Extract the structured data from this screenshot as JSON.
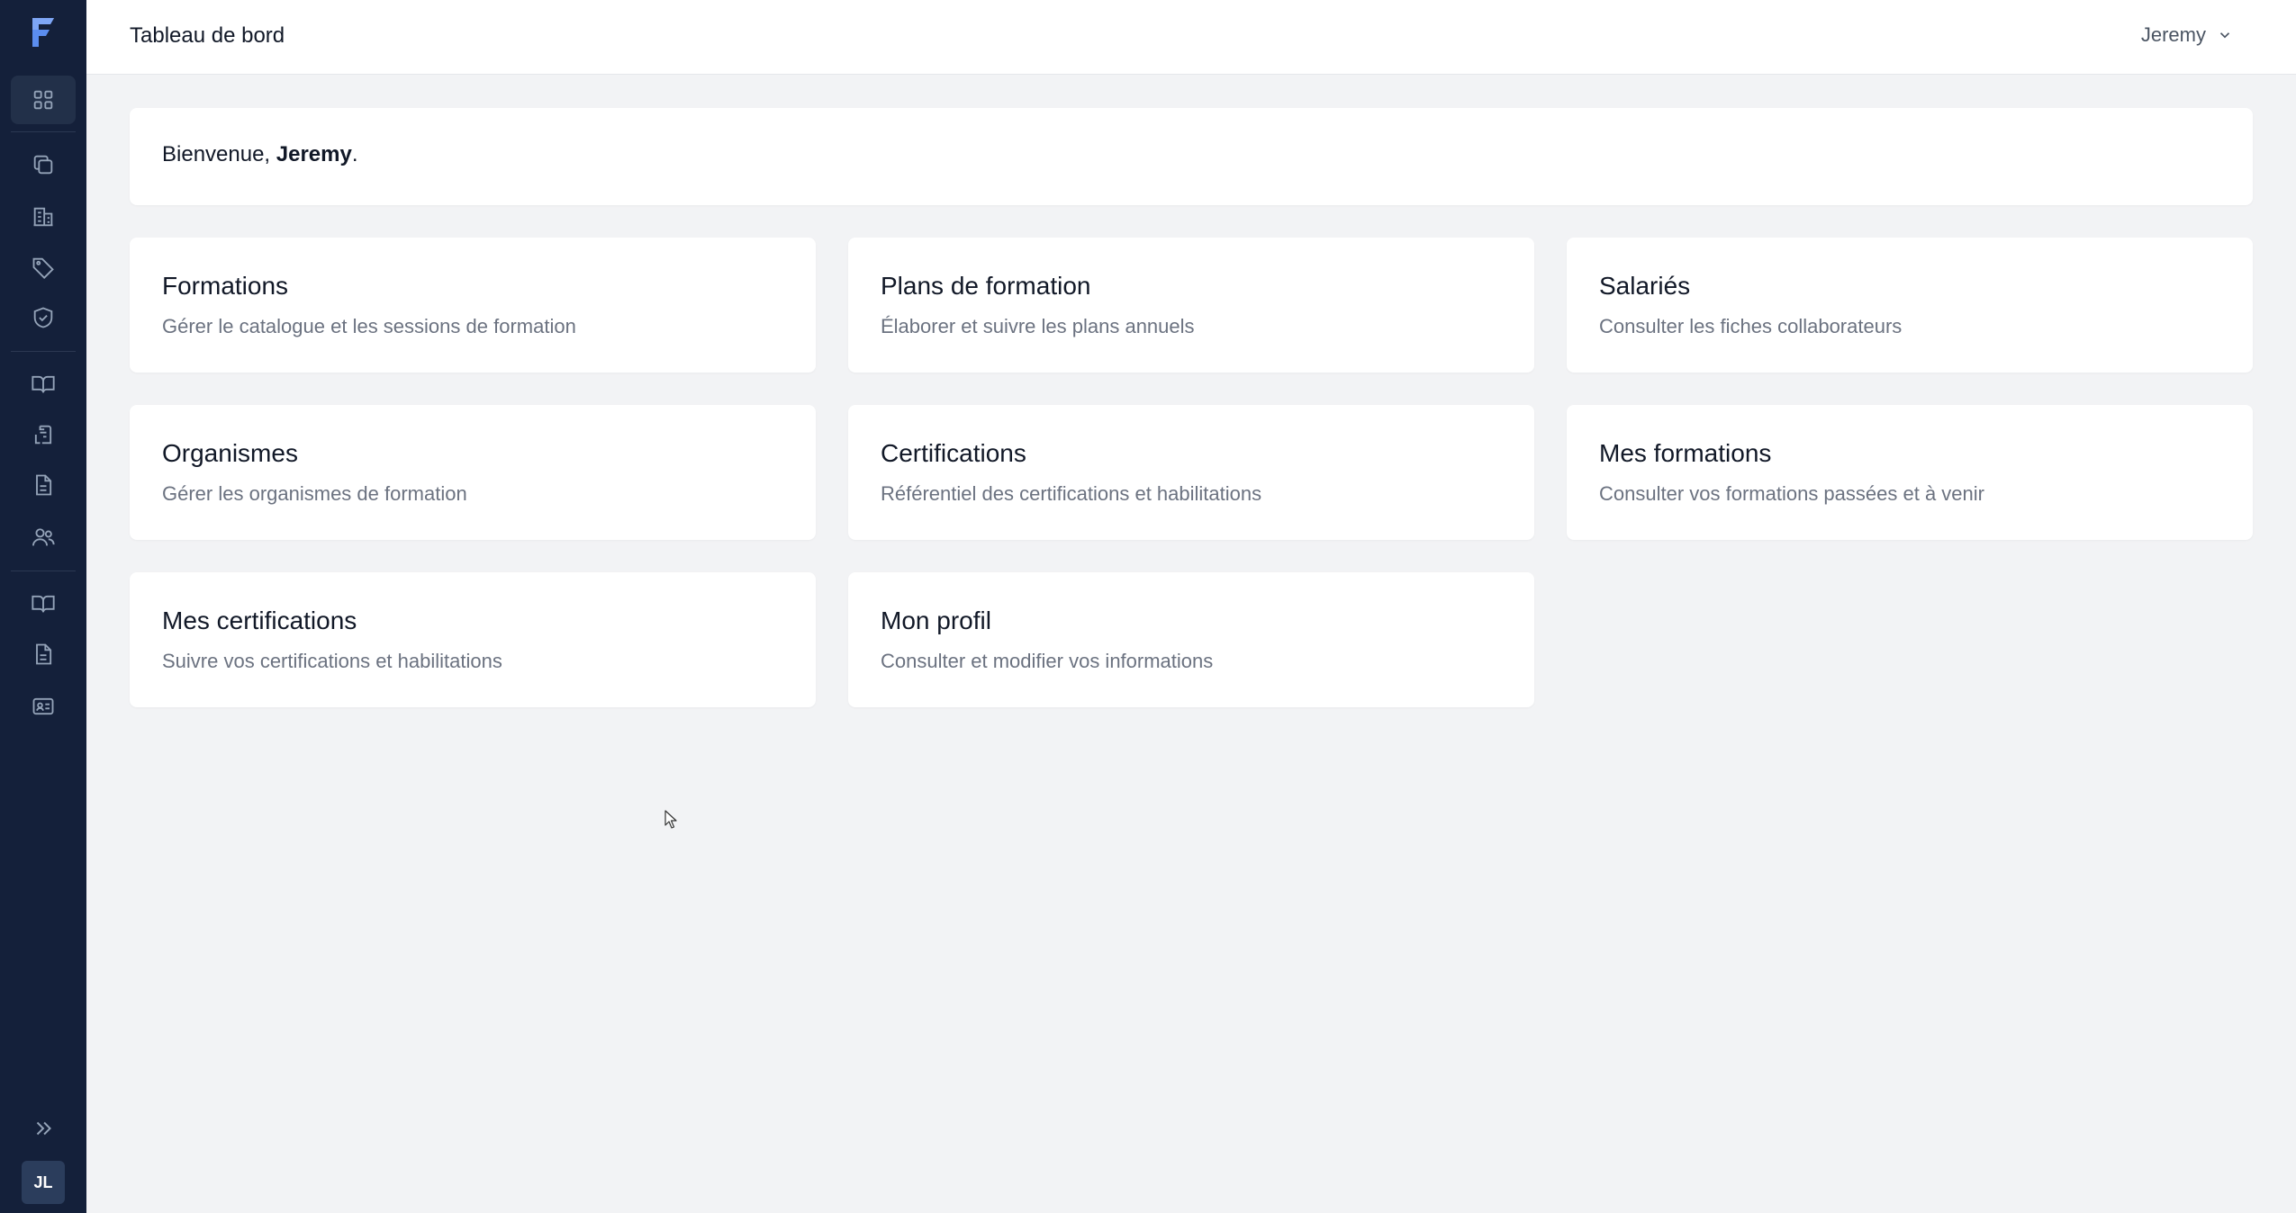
{
  "app": {
    "logo_letter": "F",
    "accent": "#3b82f6",
    "sidebar_bg": "#14203a"
  },
  "sidebar": {
    "items": [
      {
        "name": "dashboard",
        "icon": "grid-icon",
        "active": true
      },
      {
        "name": "copies",
        "icon": "copy-icon",
        "active": false
      },
      {
        "name": "buildings",
        "icon": "building-icon",
        "active": false
      },
      {
        "name": "tags",
        "icon": "tag-icon",
        "active": false
      },
      {
        "name": "shield",
        "icon": "shield-check-icon",
        "active": false
      },
      {
        "name": "catalog",
        "icon": "book-open-icon",
        "active": false
      },
      {
        "name": "clipboard",
        "icon": "clipboard-icon",
        "active": false
      },
      {
        "name": "document",
        "icon": "file-text-icon",
        "active": false
      },
      {
        "name": "users",
        "icon": "users-icon",
        "active": false
      },
      {
        "name": "my-trainings",
        "icon": "book-open-icon",
        "active": false
      },
      {
        "name": "my-docs",
        "icon": "file-text-icon",
        "active": false
      },
      {
        "name": "profile",
        "icon": "id-card-icon",
        "active": false
      }
    ],
    "expand_icon": "chevrons-right-icon",
    "avatar_initials": "JL"
  },
  "header": {
    "title": "Tableau de bord",
    "user_name": "Jeremy"
  },
  "welcome": {
    "prefix": "Bienvenue, ",
    "name": "Jeremy",
    "suffix": "."
  },
  "cards": [
    {
      "title": "Formations",
      "description": "Gérer le catalogue et les sessions de formation"
    },
    {
      "title": "Plans de formation",
      "description": "Élaborer et suivre les plans annuels"
    },
    {
      "title": "Salariés",
      "description": "Consulter les fiches collaborateurs"
    },
    {
      "title": "Organismes",
      "description": "Gérer les organismes de formation"
    },
    {
      "title": "Certifications",
      "description": "Référentiel des certifications et habilitations"
    },
    {
      "title": "Mes formations",
      "description": "Consulter vos formations passées et à venir"
    },
    {
      "title": "Mes certifications",
      "description": "Suivre vos certifications et habilitations"
    },
    {
      "title": "Mon profil",
      "description": "Consulter et modifier vos informations"
    }
  ]
}
